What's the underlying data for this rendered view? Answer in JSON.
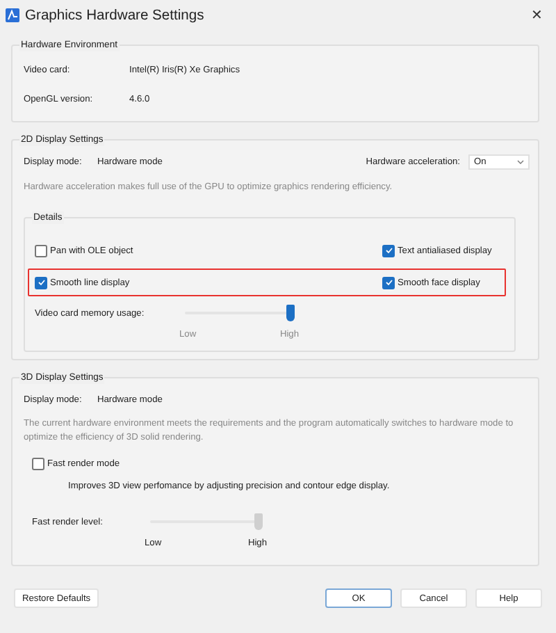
{
  "window": {
    "title": "Graphics Hardware Settings",
    "close": "✕"
  },
  "hardware_environment": {
    "title": "Hardware Environment",
    "fields": [
      {
        "label": "Video card:",
        "value": "Intel(R) Iris(R) Xe Graphics"
      },
      {
        "label": "OpenGL version:",
        "value": "4.6.0"
      }
    ]
  },
  "display_2d": {
    "title": "2D Display Settings",
    "display_mode_label": "Display mode:",
    "display_mode": "Hardware mode",
    "acceleration_label": "Hardware acceleration:",
    "acceleration": {
      "value": "On"
    },
    "description": "Hardware acceleration makes full use of the GPU to optimize graphics rendering efficiency.",
    "details": {
      "title": "Details",
      "rows": [
        {
          "highlighted": false,
          "checkboxes": [
            {
              "label": "Pan with OLE object",
              "checked": false
            },
            {
              "label": "Text antialiased display",
              "checked": true
            }
          ]
        },
        {
          "highlighted": true,
          "checkboxes": [
            {
              "label": "Smooth line display",
              "checked": true
            },
            {
              "label": "Smooth face display",
              "checked": true
            }
          ]
        }
      ],
      "slider": {
        "label": "Video card memory usage:",
        "level": 1,
        "disabled": false,
        "min_label": "Low",
        "max_label": "High"
      }
    }
  },
  "display_3d": {
    "title": "3D Display Settings",
    "display_mode_label": "Display mode:",
    "display_mode": "Hardware mode",
    "description": "The current hardware environment meets the requirements and the program automatically switches to hardware mode to optimize the efficiency of 3D solid rendering.",
    "fast_render": {
      "label": "Fast render mode",
      "checked": false
    },
    "fast_render_note": "Improves 3D view perfomance by adjusting precision and contour edge display.",
    "slider": {
      "label": "Fast render level:",
      "level": 1,
      "disabled": true,
      "min_label": "Low",
      "max_label": "High"
    }
  },
  "buttons": [
    {
      "label": "Restore Defaults",
      "default": false
    },
    {
      "label": "OK",
      "default": true
    },
    {
      "label": "Cancel",
      "default": false
    },
    {
      "label": "Help",
      "default": false
    }
  ]
}
